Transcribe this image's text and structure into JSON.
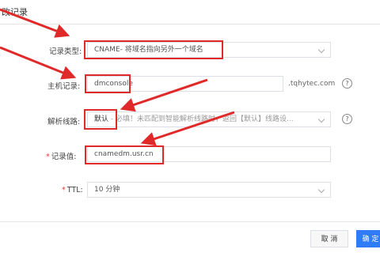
{
  "dialog": {
    "title": "改记录",
    "fields": {
      "record_type": {
        "label": "记录类型:",
        "value": "CNAME- 将域名指向另外一个域名"
      },
      "host": {
        "label": "主机记录:",
        "value": "dmconsole",
        "suffix": ".tqhytec.com"
      },
      "line": {
        "label": "解析线路:",
        "value_strong": "默认",
        "value_rest": " - 必填！未匹配到智能解析线路时，返回【默认】线路设..."
      },
      "record_value": {
        "label": "记录值:",
        "value": "cnamedm.usr.cn"
      },
      "ttl": {
        "label": "TTL:",
        "value": "10 分钟"
      }
    },
    "help_glyph": "?",
    "required_mark": "*",
    "buttons": {
      "cancel": "取 消",
      "confirm": "确 定"
    }
  },
  "colors": {
    "annotation_red": "#e02a2a",
    "primary_blue": "#2f7cf6",
    "required_red": "#e23b3b"
  }
}
